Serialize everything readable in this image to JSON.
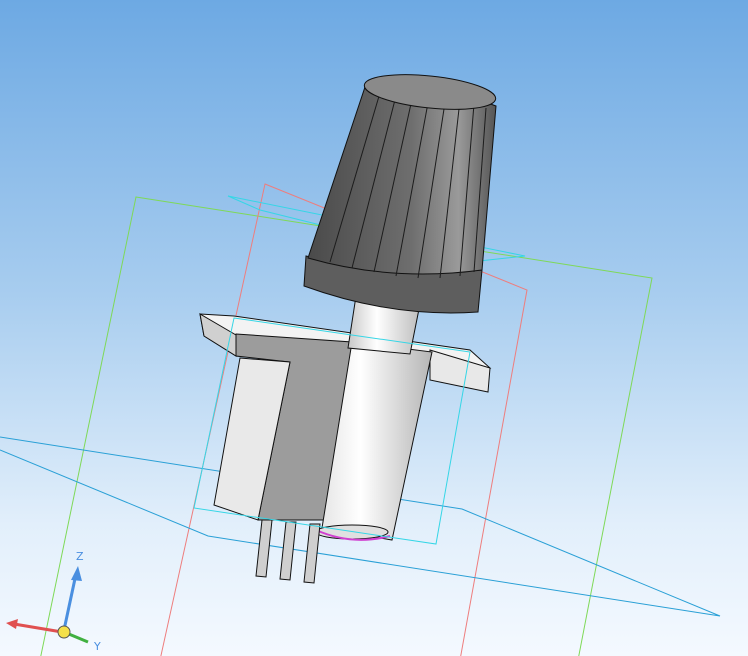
{
  "viewport": {
    "background_top": "#6da9e3",
    "background_bottom": "#f4f9ff"
  },
  "planes": {
    "front_color": "#7ed957",
    "right_color": "#ee7d7d",
    "top_color": "#2aa0d6",
    "sketch_color": "#35d6e6"
  },
  "model": {
    "knob_color": "#5a5a5a",
    "body_color": "#dcdcdc",
    "highlight_color": "#d040d0"
  },
  "triad": {
    "x_label": "",
    "y_label": "Y",
    "z_label": "Z",
    "x_color": "#e05050",
    "y_color": "#40b040",
    "z_color": "#4a8fe0"
  }
}
